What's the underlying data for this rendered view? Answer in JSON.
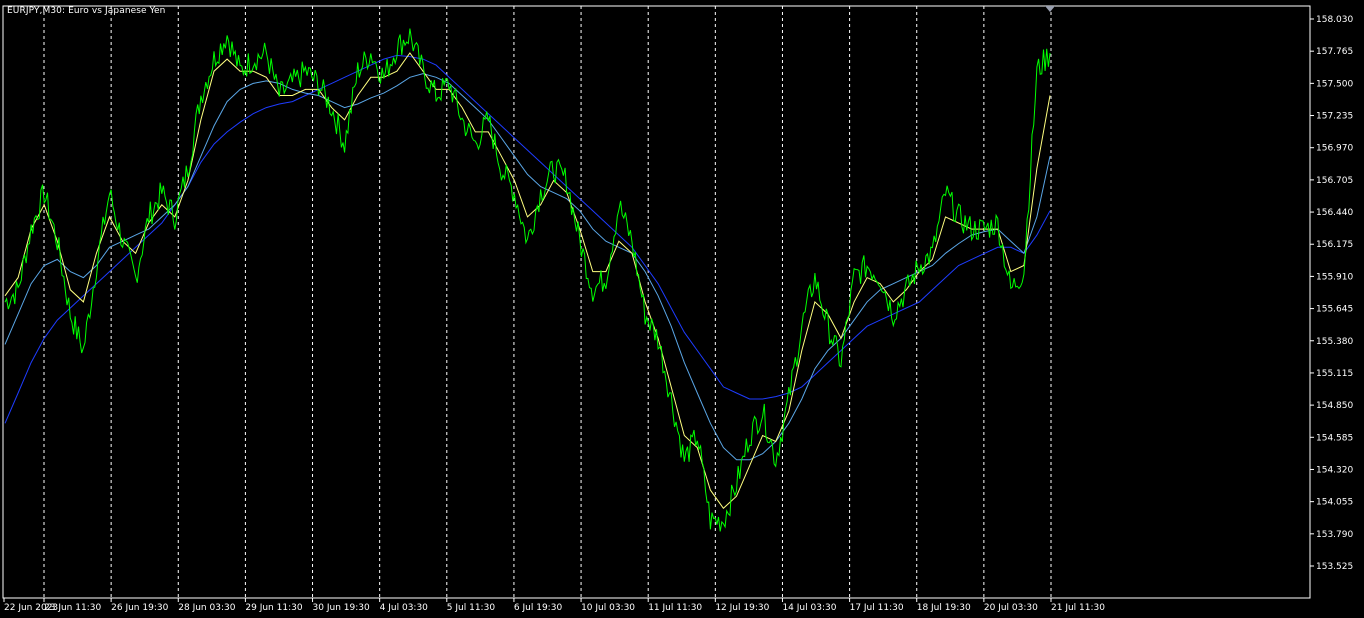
{
  "chart_title": "EURJPY,M30:  Euro vs Japanese Yen",
  "colors": {
    "background": "#000000",
    "frame": "#ffffff",
    "grid": "#ffffff",
    "price": "#00ff00",
    "ma_fast": "#ffff80",
    "ma_mid": "#5aa6e6",
    "ma_slow": "#1e3cff"
  },
  "chart_data": {
    "type": "line",
    "title": "EURJPY,M30:  Euro vs Japanese Yen",
    "ylim": [
      153.4,
      158.1
    ],
    "y_ticks": [
      "158.030",
      "157.765",
      "157.500",
      "157.235",
      "156.970",
      "156.705",
      "156.440",
      "156.175",
      "155.910",
      "155.645",
      "155.380",
      "155.115",
      "154.850",
      "154.585",
      "154.320",
      "154.055",
      "153.790",
      "153.525"
    ],
    "x_ticks": [
      "22 Jun 2023",
      "23 Jun 11:30",
      "26 Jun 19:30",
      "28 Jun 03:30",
      "29 Jun 11:30",
      "30 Jun 19:30",
      "4 Jul 03:30",
      "5 Jul 11:30",
      "6 Jul 19:30",
      "10 Jul 03:30",
      "11 Jul 11:30",
      "12 Jul 19:30",
      "14 Jul 03:30",
      "17 Jul 11:30",
      "18 Jul 19:30",
      "20 Jul 03:30",
      "21 Jul 11:30"
    ],
    "grid": "vertical dashed",
    "series": [
      {
        "key": "price",
        "color": "#00ff00",
        "values": [
          155.7,
          155.8,
          156.3,
          156.6,
          156.2,
          155.6,
          155.3,
          156.0,
          156.6,
          156.2,
          155.9,
          156.4,
          156.6,
          156.4,
          156.8,
          157.4,
          157.7,
          157.9,
          157.6,
          157.7,
          157.75,
          157.4,
          157.5,
          157.6,
          157.5,
          157.3,
          157.0,
          157.6,
          157.75,
          157.55,
          157.8,
          157.9,
          157.6,
          157.4,
          157.5,
          157.2,
          157.0,
          157.2,
          156.8,
          156.6,
          156.2,
          156.6,
          156.8,
          156.7,
          156.2,
          155.8,
          155.9,
          156.5,
          156.2,
          155.6,
          155.4,
          154.9,
          154.4,
          154.6,
          153.9,
          153.9,
          154.2,
          154.6,
          154.8,
          154.4,
          154.9,
          155.5,
          155.9,
          155.5,
          155.2,
          155.9,
          156.0,
          155.9,
          155.6,
          155.8,
          156.0,
          156.1,
          156.6,
          156.4,
          156.3,
          156.3,
          156.35,
          155.8,
          155.95,
          157.6,
          157.75
        ]
      },
      {
        "key": "ma_fast",
        "color": "#ffff80",
        "values": [
          155.75,
          155.9,
          156.3,
          156.5,
          156.2,
          155.8,
          155.7,
          156.1,
          156.4,
          156.2,
          156.1,
          156.35,
          156.5,
          156.4,
          156.7,
          157.2,
          157.6,
          157.7,
          157.6,
          157.6,
          157.55,
          157.4,
          157.4,
          157.45,
          157.45,
          157.3,
          157.2,
          157.4,
          157.55,
          157.55,
          157.6,
          157.75,
          157.6,
          157.45,
          157.45,
          157.3,
          157.1,
          157.1,
          156.9,
          156.7,
          156.4,
          156.5,
          156.7,
          156.6,
          156.3,
          155.95,
          155.95,
          156.2,
          156.1,
          155.7,
          155.4,
          155.0,
          154.6,
          154.5,
          154.15,
          154.0,
          154.1,
          154.35,
          154.6,
          154.55,
          154.8,
          155.3,
          155.7,
          155.6,
          155.4,
          155.7,
          155.9,
          155.85,
          155.7,
          155.8,
          155.95,
          156.05,
          156.4,
          156.35,
          156.3,
          156.3,
          156.3,
          155.95,
          156.0,
          156.8,
          157.4
        ]
      },
      {
        "key": "ma_mid",
        "color": "#5aa6e6",
        "values": [
          155.35,
          155.6,
          155.85,
          156.0,
          156.05,
          155.95,
          155.9,
          156.0,
          156.15,
          156.2,
          156.25,
          156.3,
          156.4,
          156.5,
          156.65,
          156.9,
          157.15,
          157.35,
          157.45,
          157.5,
          157.52,
          157.5,
          157.45,
          157.42,
          157.4,
          157.35,
          157.3,
          157.33,
          157.38,
          157.42,
          157.48,
          157.55,
          157.58,
          157.55,
          157.5,
          157.4,
          157.3,
          157.2,
          157.05,
          156.9,
          156.75,
          156.65,
          156.6,
          156.55,
          156.45,
          156.3,
          156.2,
          156.15,
          156.1,
          155.95,
          155.75,
          155.5,
          155.2,
          154.95,
          154.7,
          154.5,
          154.4,
          154.4,
          154.45,
          154.55,
          154.7,
          154.9,
          155.15,
          155.3,
          155.4,
          155.55,
          155.7,
          155.8,
          155.85,
          155.9,
          155.95,
          156.0,
          156.1,
          156.18,
          156.25,
          156.28,
          156.3,
          156.2,
          156.1,
          156.4,
          156.9
        ]
      },
      {
        "key": "ma_slow",
        "color": "#1e3cff",
        "values": [
          154.7,
          154.95,
          155.2,
          155.4,
          155.55,
          155.65,
          155.75,
          155.85,
          155.95,
          156.05,
          156.15,
          156.25,
          156.35,
          156.5,
          156.65,
          156.85,
          157.0,
          157.1,
          157.18,
          157.25,
          157.3,
          157.33,
          157.35,
          157.4,
          157.45,
          157.5,
          157.55,
          157.6,
          157.65,
          157.7,
          157.73,
          157.72,
          157.7,
          157.65,
          157.55,
          157.45,
          157.35,
          157.25,
          157.15,
          157.05,
          156.95,
          156.85,
          156.75,
          156.65,
          156.55,
          156.45,
          156.35,
          156.25,
          156.15,
          156.0,
          155.85,
          155.65,
          155.45,
          155.3,
          155.15,
          155.0,
          154.95,
          154.9,
          154.9,
          154.92,
          154.95,
          155.0,
          155.1,
          155.2,
          155.3,
          155.4,
          155.5,
          155.55,
          155.6,
          155.65,
          155.7,
          155.8,
          155.9,
          156.0,
          156.05,
          156.1,
          156.15,
          156.15,
          156.1,
          156.25,
          156.45
        ]
      }
    ]
  }
}
